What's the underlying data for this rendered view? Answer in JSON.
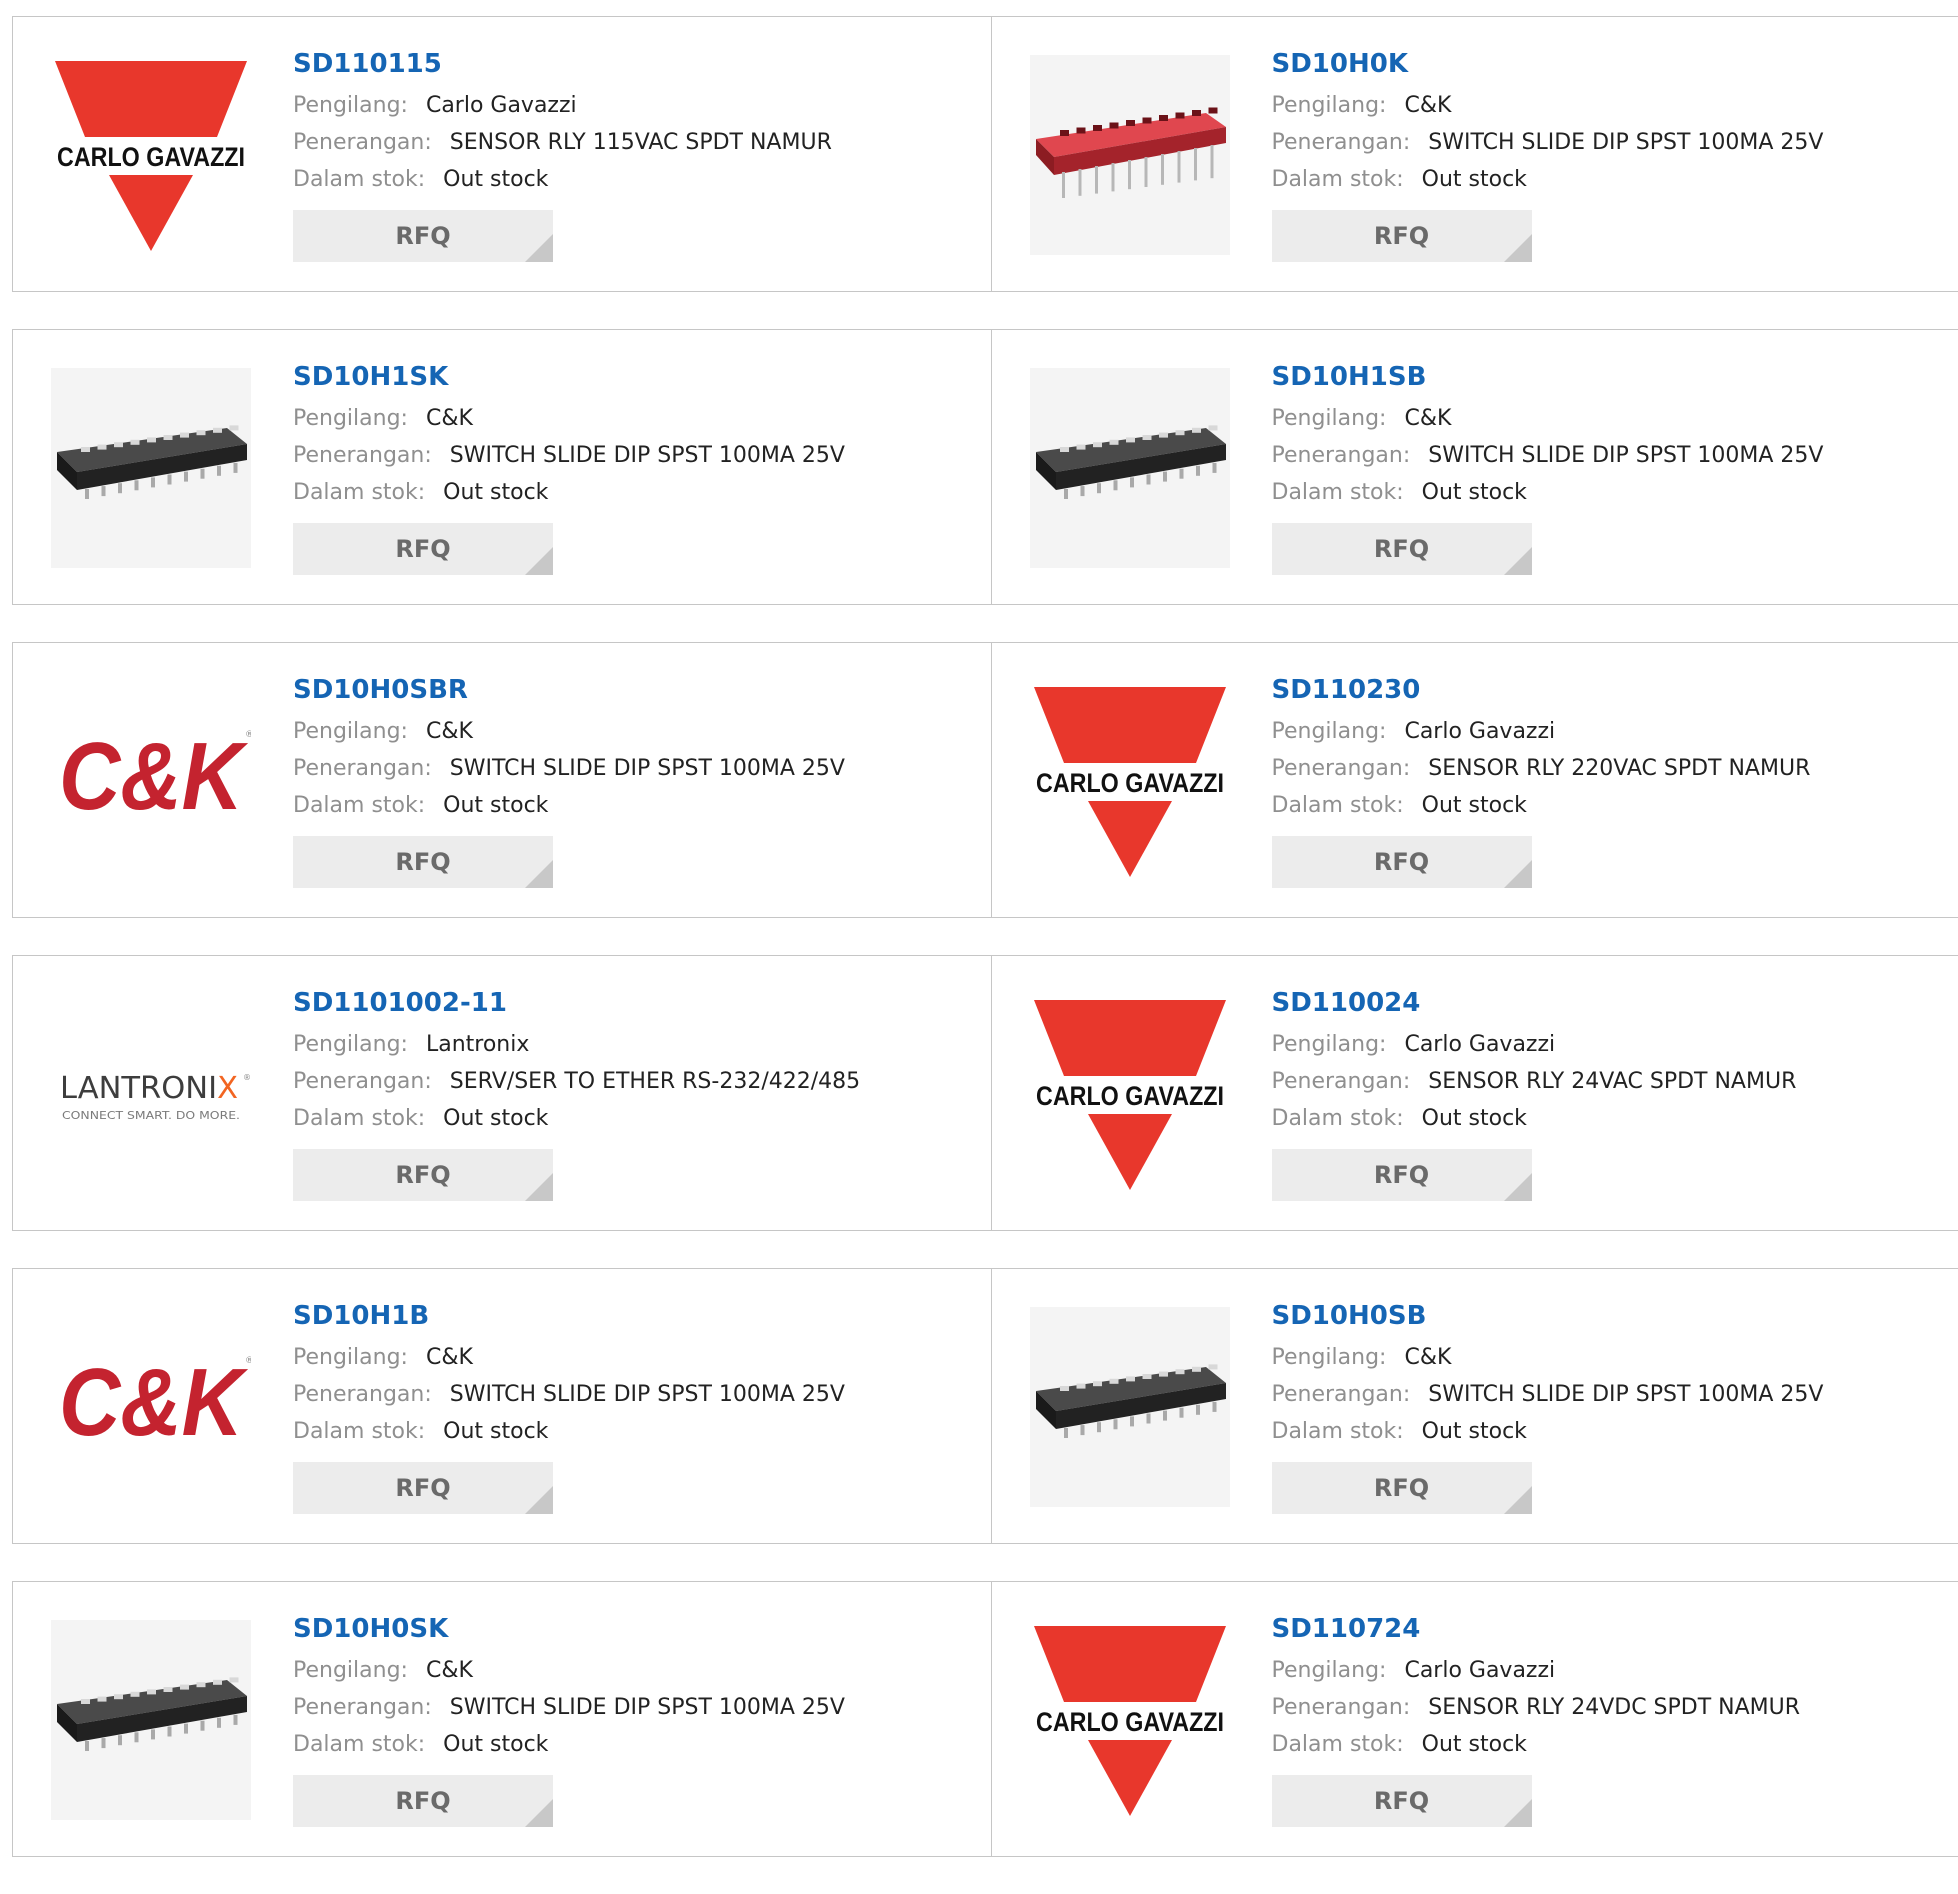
{
  "labels": {
    "manufacturer": "Pengilang:",
    "description": "Penerangan:",
    "stock": "Dalam stok:",
    "rfq": "RFQ"
  },
  "brand_text": {
    "carlo_gavazzi": "CARLO GAVAZZI",
    "ck": "C&K",
    "lantronix": "LANTRONIX",
    "lantronix_tagline": "CONNECT SMART. DO MORE."
  },
  "colors": {
    "title_link": "#1565b4",
    "carlo_red": "#e8372c",
    "ck_red": "#c4232f",
    "lantronix_orange": "#f26522",
    "rfq_bg": "#ececec"
  },
  "products": [
    {
      "part": "SD110115",
      "manufacturer": "Carlo Gavazzi",
      "description": "SENSOR RLY 115VAC SPDT NAMUR",
      "stock": "Out stock",
      "image": "carlo-gavazzi-logo"
    },
    {
      "part": "SD10H0K",
      "manufacturer": "C&K",
      "description": "SWITCH SLIDE DIP SPST 100MA 25V",
      "stock": "Out stock",
      "image": "red-dip-switch-photo"
    },
    {
      "part": "SD10H1SK",
      "manufacturer": "C&K",
      "description": "SWITCH SLIDE DIP SPST 100MA 25V",
      "stock": "Out stock",
      "image": "black-dip-switch-photo"
    },
    {
      "part": "SD10H1SB",
      "manufacturer": "C&K",
      "description": "SWITCH SLIDE DIP SPST 100MA 25V",
      "stock": "Out stock",
      "image": "black-dip-switch-photo"
    },
    {
      "part": "SD10H0SBR",
      "manufacturer": "C&K",
      "description": "SWITCH SLIDE DIP SPST 100MA 25V",
      "stock": "Out stock",
      "image": "ck-logo"
    },
    {
      "part": "SD110230",
      "manufacturer": "Carlo Gavazzi",
      "description": "SENSOR RLY 220VAC SPDT NAMUR",
      "stock": "Out stock",
      "image": "carlo-gavazzi-logo"
    },
    {
      "part": "SD1101002-11",
      "manufacturer": "Lantronix",
      "description": "SERV/SER TO ETHER RS-232/422/485",
      "stock": "Out stock",
      "image": "lantronix-logo"
    },
    {
      "part": "SD110024",
      "manufacturer": "Carlo Gavazzi",
      "description": "SENSOR RLY 24VAC SPDT NAMUR",
      "stock": "Out stock",
      "image": "carlo-gavazzi-logo"
    },
    {
      "part": "SD10H1B",
      "manufacturer": "C&K",
      "description": "SWITCH SLIDE DIP SPST 100MA 25V",
      "stock": "Out stock",
      "image": "ck-logo"
    },
    {
      "part": "SD10H0SB",
      "manufacturer": "C&K",
      "description": "SWITCH SLIDE DIP SPST 100MA 25V",
      "stock": "Out stock",
      "image": "black-dip-switch-photo"
    },
    {
      "part": "SD10H0SK",
      "manufacturer": "C&K",
      "description": "SWITCH SLIDE DIP SPST 100MA 25V",
      "stock": "Out stock",
      "image": "black-dip-switch-photo"
    },
    {
      "part": "SD110724",
      "manufacturer": "Carlo Gavazzi",
      "description": "SENSOR RLY 24VDC SPDT NAMUR",
      "stock": "Out stock",
      "image": "carlo-gavazzi-logo"
    }
  ]
}
